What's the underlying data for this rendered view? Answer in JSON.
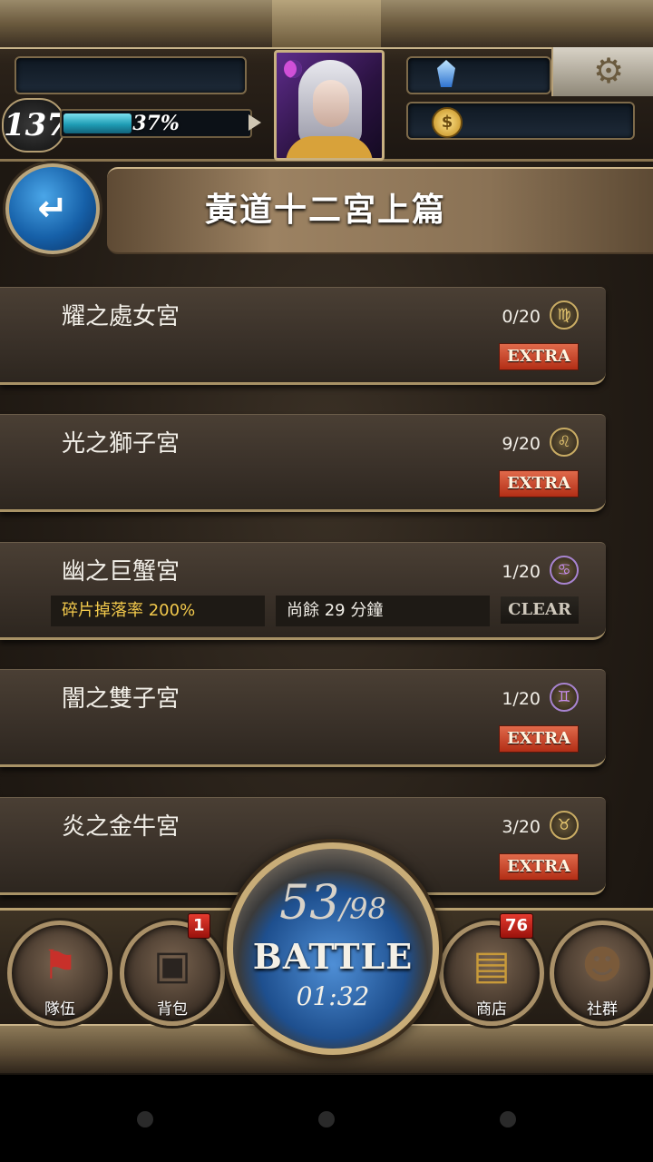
{
  "header": {
    "level": "137",
    "exp_percent_label": "37%",
    "exp_fraction": 0.37
  },
  "title": {
    "text": "黃道十二宮上篇"
  },
  "stages": [
    {
      "name": "耀之處女宮",
      "progress": "0/20",
      "zodiac": "♍",
      "zodiac_icon": "virgo-icon",
      "badge": "EXTRA"
    },
    {
      "name": "光之獅子宮",
      "progress": "9/20",
      "zodiac": "♌",
      "zodiac_icon": "leo-icon",
      "badge": "EXTRA"
    },
    {
      "name": "幽之巨蟹宮",
      "progress": "1/20",
      "zodiac": "♋",
      "zodiac_icon": "cancer-icon",
      "badge": "CLEAR",
      "drop_rate": "碎片掉落率 200%",
      "time_left": "尚餘 29 分鐘"
    },
    {
      "name": "闇之雙子宮",
      "progress": "1/20",
      "zodiac": "♊",
      "zodiac_icon": "gemini-icon",
      "badge": "EXTRA"
    },
    {
      "name": "炎之金牛宮",
      "progress": "3/20",
      "zodiac": "♉",
      "zodiac_icon": "taurus-icon",
      "badge": "EXTRA"
    }
  ],
  "nav": {
    "team": {
      "label": "隊伍",
      "icon": "flag-icon"
    },
    "bag": {
      "label": "背包",
      "icon": "bag-icon",
      "badge": "1"
    },
    "shop": {
      "label": "商店",
      "icon": "treasure-chest-icon",
      "badge": "76"
    },
    "social": {
      "label": "社群",
      "icon": "people-icon"
    }
  },
  "battle": {
    "current": "53",
    "max": "/98",
    "label": "BATTLE",
    "timer": "01:32"
  },
  "colors": {
    "accent_gold": "#c9ad78",
    "extra_red": "#b22e16",
    "drop_rate_yellow": "#f2c94c",
    "exp_cyan": "#1f9db5",
    "battle_blue": "#1e4f8e"
  }
}
